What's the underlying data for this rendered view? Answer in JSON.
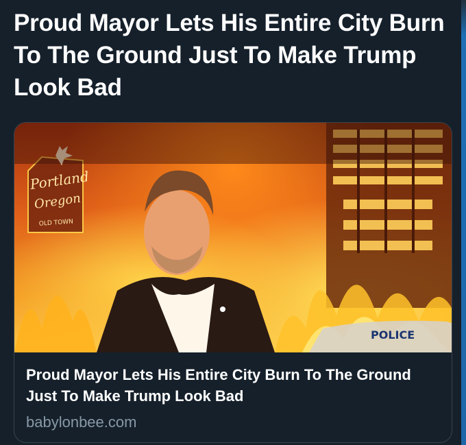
{
  "tweet": {
    "text": "Proud Mayor Lets His Entire City Burn To The Ground Just To Make Trump Look Bad"
  },
  "card": {
    "title": "Proud Mayor Lets His Entire City Burn To The Ground Just To Make Trump Look Bad",
    "domain": "babylonbee.com",
    "image": {
      "sign_line1": "Portland",
      "sign_line2": "Oregon",
      "sign_line3": "OLD TOWN",
      "car_text": "POLICE"
    }
  },
  "colors": {
    "background": "#15202b",
    "card_border": "#38444d",
    "domain_text": "#8899a6",
    "title_text": "#ffffff",
    "accent_edge": "#1e66a8"
  }
}
